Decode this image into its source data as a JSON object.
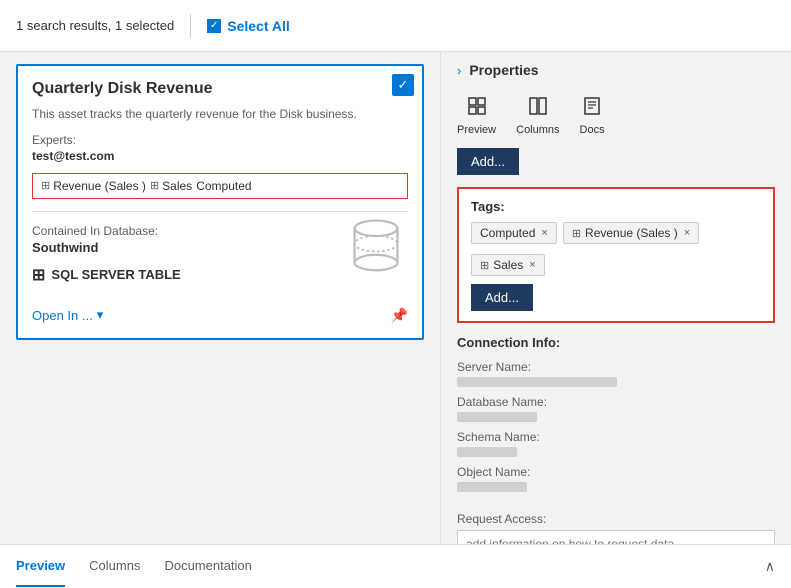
{
  "topbar": {
    "search_results": "1 search results, 1 selected",
    "select_all": "Select All"
  },
  "card": {
    "title": "Quarterly Disk Revenue",
    "description": "This asset tracks the quarterly revenue for the Disk business.",
    "experts_label": "Experts:",
    "experts_value": "test@test.com",
    "tags": [
      {
        "label": "Revenue (Sales )",
        "has_icon": true
      },
      {
        "label": "Sales",
        "has_icon": true
      },
      {
        "label": "Computed",
        "has_icon": false
      }
    ],
    "contained_label": "Contained In Database:",
    "contained_value": "Southwind",
    "type_label": "SQL SERVER TABLE",
    "open_in": "Open In ...",
    "check": "✓"
  },
  "bottom_tabs": {
    "tabs": [
      {
        "label": "Preview",
        "active": true
      },
      {
        "label": "Columns",
        "active": false
      },
      {
        "label": "Documentation",
        "active": false
      }
    ]
  },
  "right_panel": {
    "title": "Properties",
    "toolbar": [
      {
        "label": "Preview",
        "icon": "⊞"
      },
      {
        "label": "Columns",
        "icon": "☰"
      },
      {
        "label": "Docs",
        "icon": "☰"
      }
    ],
    "add_button": "Add...",
    "tags_section": {
      "label": "Tags:",
      "tags": [
        {
          "label": "Computed",
          "has_icon": false
        },
        {
          "label": "Revenue (Sales )",
          "has_icon": true
        },
        {
          "label": "Sales",
          "has_icon": true
        }
      ],
      "add_button": "Add..."
    },
    "connection_section": {
      "label": "Connection Info:",
      "fields": [
        {
          "label": "Server Name:"
        },
        {
          "label": "Database Name:"
        },
        {
          "label": "Schema Name:"
        },
        {
          "label": "Object Name:"
        }
      ]
    },
    "request_access": {
      "label": "Request Access:",
      "placeholder": "add information on how to request data"
    }
  }
}
